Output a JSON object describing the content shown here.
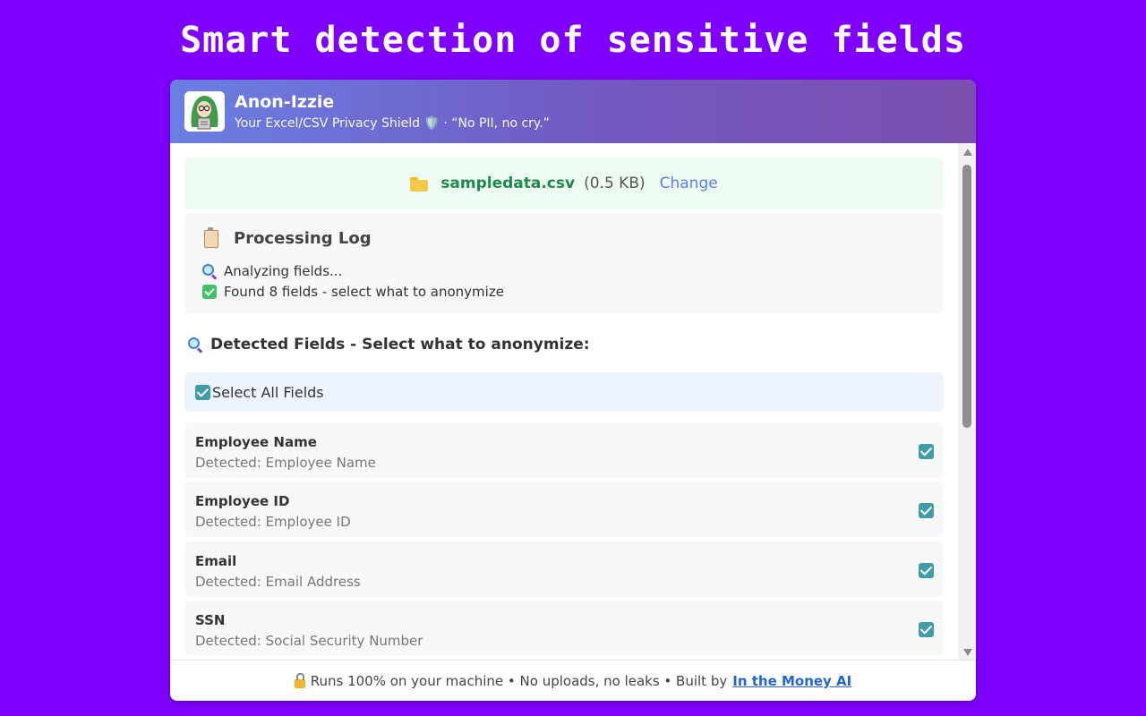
{
  "headline": "Smart detection of sensitive fields",
  "app": {
    "title": "Anon-Izzie",
    "subtitle": "Your Excel/CSV Privacy Shield 🛡️ · “No PII, no cry.”"
  },
  "file": {
    "name": "sampledata.csv",
    "size": "(0.5 KB)",
    "change_label": "Change"
  },
  "log": {
    "title": "Processing Log",
    "lines": [
      "Analyzing fields...",
      "Found 8 fields - select what to anonymize"
    ]
  },
  "detected": {
    "title": "Detected Fields - Select what to anonymize:",
    "select_all_label": "Select All Fields",
    "select_all_checked": true,
    "fields": [
      {
        "name": "Employee Name",
        "detected": "Detected: Employee Name",
        "checked": true
      },
      {
        "name": "Employee ID",
        "detected": "Detected: Employee ID",
        "checked": true
      },
      {
        "name": "Email",
        "detected": "Detected: Email Address",
        "checked": true
      },
      {
        "name": "SSN",
        "detected": "Detected: Social Security Number",
        "checked": true
      }
    ]
  },
  "footer": {
    "text": "Runs 100% on your machine • No uploads, no leaks • Built by",
    "link": "In the Money AI"
  },
  "colors": {
    "background": "#7F00FF",
    "accent_checkbox": "#3f9ca8",
    "file_name_green": "#1f8a4c",
    "link_blue": "#2563d6"
  }
}
